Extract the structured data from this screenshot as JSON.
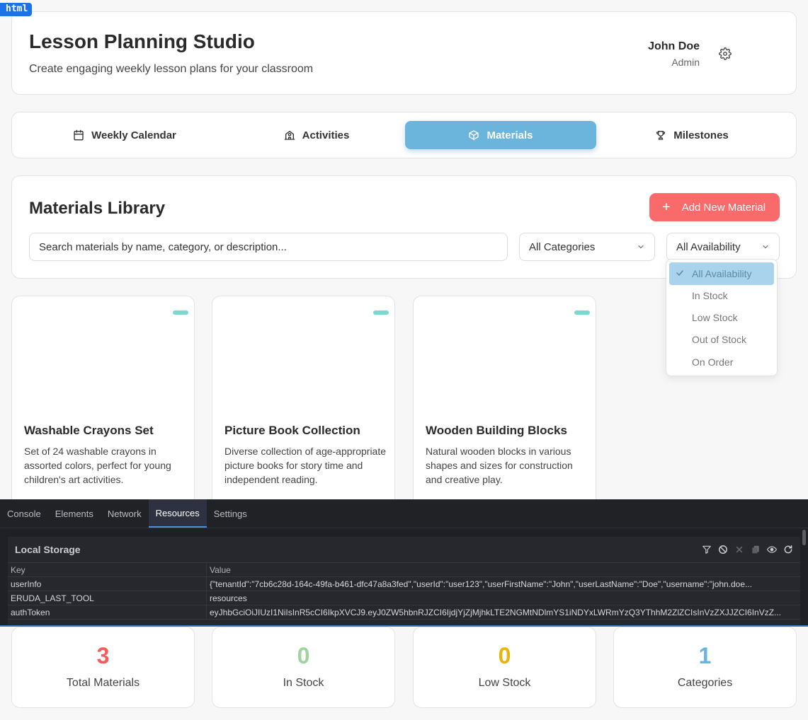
{
  "badge": "html",
  "header": {
    "title": "Lesson Planning Studio",
    "subtitle": "Create engaging weekly lesson plans for your classroom",
    "user_name": "John Doe",
    "user_role": "Admin"
  },
  "tabs": [
    {
      "label": "Weekly Calendar",
      "icon": "calendar-icon",
      "active": false
    },
    {
      "label": "Activities",
      "icon": "school-icon",
      "active": false
    },
    {
      "label": "Materials",
      "icon": "box-icon",
      "active": true
    },
    {
      "label": "Milestones",
      "icon": "trophy-icon",
      "active": false
    }
  ],
  "library": {
    "title": "Materials Library",
    "add_label": "Add New Material",
    "search_placeholder": "Search materials by name, category, or description...",
    "category_selected": "All Categories",
    "availability_selected": "All Availability"
  },
  "availability_options": [
    "All Availability",
    "In Stock",
    "Low Stock",
    "Out of Stock",
    "On Order"
  ],
  "materials": [
    {
      "name": "Washable Crayons Set",
      "description": "Set of 24 washable crayons in assorted colors, perfect for young children's art activities."
    },
    {
      "name": "Picture Book Collection",
      "description": "Diverse collection of age-appropriate picture books for story time and independent reading."
    },
    {
      "name": "Wooden Building Blocks",
      "description": "Natural wooden blocks in various shapes and sizes for construction and creative play."
    }
  ],
  "devtools": {
    "tabs": [
      "Console",
      "Elements",
      "Network",
      "Resources",
      "Settings"
    ],
    "active_tab": "Resources",
    "panel_title": "Local Storage",
    "columns": [
      "Key",
      "Value"
    ],
    "rows": [
      {
        "key": "userInfo",
        "value": "{\"tenantId\":\"7cb6c28d-164c-49fa-b461-dfc47a8a3fed\",\"userId\":\"user123\",\"userFirstName\":\"John\",\"userLastName\":\"Doe\",\"username\":\"john.doe..."
      },
      {
        "key": "ERUDA_LAST_TOOL",
        "value": "resources"
      },
      {
        "key": "authToken",
        "value": "eyJhbGciOiJIUzI1NiIsInR5cCI6IkpXVCJ9.eyJ0ZW5hbnRJZCI6IjdjYjZjMjhkLTE2NGMtNDlmYS1iNDYxLWRmYzQ3YThhM2ZlZCIsInVzZXJJZCI6InVzZ..."
      }
    ]
  },
  "stats": [
    {
      "value": "3",
      "label": "Total Materials",
      "color": "#f45d5d"
    },
    {
      "value": "0",
      "label": "In Stock",
      "color": "#9fd39f"
    },
    {
      "value": "0",
      "label": "Low Stock",
      "color": "#e8b40a"
    },
    {
      "value": "1",
      "label": "Categories",
      "color": "#6bb4dc"
    }
  ],
  "colors": {
    "accent_blue": "#6bb4dc",
    "accent_red": "#f96b6b",
    "availability_pill": "#7ad8cf"
  }
}
